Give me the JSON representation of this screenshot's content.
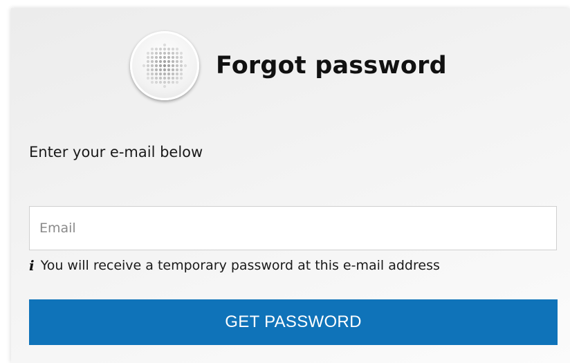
{
  "header": {
    "logo_icon": "dotted-globe-logo-icon",
    "title": "Forgot password"
  },
  "form": {
    "instruction": "Enter your e-mail below",
    "email_placeholder": "Email",
    "email_value": "",
    "hint_icon": "info-icon",
    "hint_text": "You will receive a temporary password at this e-mail address",
    "submit_label": "GET PASSWORD"
  },
  "colors": {
    "accent": "#0f73b9",
    "button_text": "#ffffff",
    "title_text": "#111111",
    "input_border": "#cfcfcf"
  }
}
